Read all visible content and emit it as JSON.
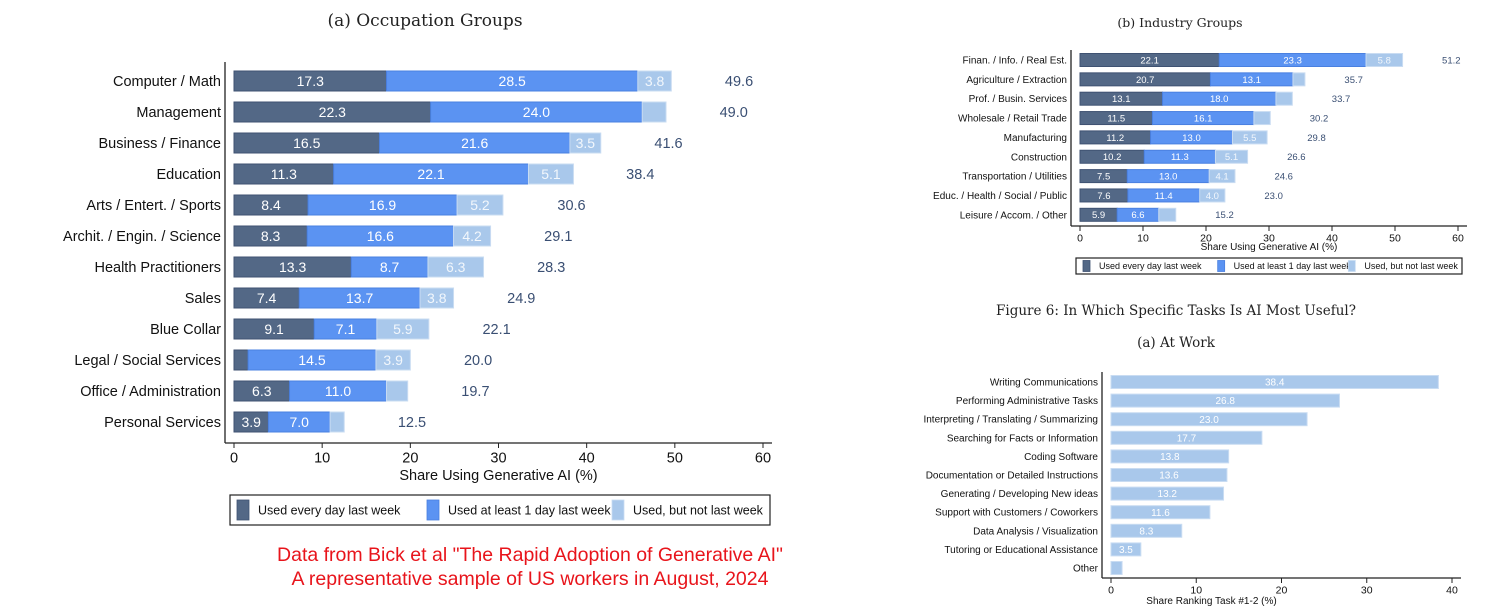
{
  "colors": {
    "daily": "#536886",
    "weekly": "#5b93f2",
    "notlast": "#a9c8eb",
    "total_label": "#3a4f73",
    "note": "#e8141b"
  },
  "chart_data": [
    {
      "id": "occupation",
      "type": "bar",
      "orientation": "horizontal",
      "stacked": true,
      "title": "(a) Occupation Groups",
      "xlabel": "Share Using Generative AI (%)",
      "xlim": [
        0,
        60
      ],
      "xticks": [
        0,
        10,
        20,
        30,
        40,
        50,
        60
      ],
      "legend": {
        "position": "bottom",
        "entries": [
          "Used every day last week",
          "Used at least 1 day last week",
          "Used, but not last week"
        ]
      },
      "categories": [
        "Computer / Math",
        "Management",
        "Business / Finance",
        "Education",
        "Arts / Entert. / Sports",
        "Archit. / Engin. / Science",
        "Health Practitioners",
        "Sales",
        "Blue Collar",
        "Legal / Social Services",
        "Office / Administration",
        "Personal Services"
      ],
      "series": [
        {
          "name": "Used every day last week",
          "values": [
            17.3,
            22.3,
            16.5,
            11.3,
            8.4,
            8.3,
            13.3,
            7.4,
            9.1,
            1.6,
            6.3,
            3.9
          ],
          "labels": [
            "17.3",
            "22.3",
            "16.5",
            "11.3",
            "8.4",
            "8.3",
            "13.3",
            "7.4",
            "9.1",
            "",
            "6.3",
            "3.9"
          ]
        },
        {
          "name": "Used at least 1 day last week",
          "values": [
            28.5,
            24.0,
            21.6,
            22.1,
            16.9,
            16.6,
            8.7,
            13.7,
            7.1,
            14.5,
            11.0,
            7.0
          ],
          "labels": [
            "28.5",
            "24.0",
            "21.6",
            "22.1",
            "16.9",
            "16.6",
            "8.7",
            "13.7",
            "7.1",
            "14.5",
            "11.0",
            "7.0"
          ]
        },
        {
          "name": "Used, but not last week",
          "values": [
            3.8,
            2.7,
            3.5,
            5.1,
            5.2,
            4.2,
            6.3,
            3.8,
            5.9,
            3.9,
            2.4,
            1.6
          ],
          "labels": [
            "3.8",
            "",
            "3.5",
            "5.1",
            "5.2",
            "4.2",
            "6.3",
            "3.8",
            "5.9",
            "3.9",
            "",
            ""
          ]
        }
      ],
      "totals": [
        "49.6",
        "49.0",
        "41.6",
        "38.4",
        "30.6",
        "29.1",
        "28.3",
        "24.9",
        "22.1",
        "20.0",
        "19.7",
        "12.5"
      ],
      "grid": false
    },
    {
      "id": "industry",
      "type": "bar",
      "orientation": "horizontal",
      "stacked": true,
      "title": "(b) Industry Groups",
      "xlabel": "Share Using Generative AI (%)",
      "xlim": [
        0,
        60
      ],
      "xticks": [
        0,
        10,
        20,
        30,
        40,
        50,
        60
      ],
      "legend": {
        "position": "bottom",
        "entries": [
          "Used every day last week",
          "Used at least 1 day last week",
          "Used, but not last week"
        ]
      },
      "categories": [
        "Finan. / Info. / Real Est.",
        "Agriculture / Extraction",
        "Prof. / Busin. Services",
        "Wholesale / Retail Trade",
        "Manufacturing",
        "Construction",
        "Transportation / Utilities",
        "Educ. / Health / Social / Public",
        "Leisure / Accom. / Other"
      ],
      "series": [
        {
          "name": "Used every day last week",
          "values": [
            22.1,
            20.7,
            13.1,
            11.5,
            11.2,
            10.2,
            7.5,
            7.6,
            5.9
          ],
          "labels": [
            "22.1",
            "20.7",
            "13.1",
            "11.5",
            "11.2",
            "10.2",
            "7.5",
            "7.6",
            "5.9"
          ]
        },
        {
          "name": "Used at least 1 day last week",
          "values": [
            23.3,
            13.1,
            18.0,
            16.1,
            13.0,
            11.3,
            13.0,
            11.4,
            6.6
          ],
          "labels": [
            "23.3",
            "13.1",
            "18.0",
            "16.1",
            "13.0",
            "11.3",
            "13.0",
            "11.4",
            "6.6"
          ]
        },
        {
          "name": "Used, but not last week",
          "values": [
            5.8,
            1.9,
            2.6,
            2.6,
            5.5,
            5.1,
            4.1,
            4.0,
            2.7
          ],
          "labels": [
            "5.8",
            "",
            "",
            "",
            "5.5",
            "5.1",
            "4.1",
            "4.0",
            ""
          ]
        }
      ],
      "totals": [
        "51.2",
        "35.7",
        "33.7",
        "30.2",
        "29.8",
        "26.6",
        "24.6",
        "23.0",
        "15.2"
      ],
      "grid": false
    },
    {
      "id": "tasks",
      "type": "bar",
      "orientation": "horizontal",
      "figure_title": "Figure 6: In Which Specific Tasks Is AI Most Useful?",
      "title": "(a) At Work",
      "xlabel": "Share Ranking Task #1-2 (%)",
      "xlim": [
        0,
        40
      ],
      "xticks": [
        0,
        10,
        20,
        30,
        40
      ],
      "categories": [
        "Writing Communications",
        "Performing Administrative Tasks",
        "Interpreting / Translating / Summarizing",
        "Searching for Facts or Information",
        "Coding Software",
        "Documentation or Detailed Instructions",
        "Generating / Developing New ideas",
        "Support with Customers / Coworkers",
        "Data Analysis / Visualization",
        "Tutoring or Educational Assistance",
        "Other"
      ],
      "values": [
        38.4,
        26.8,
        23.0,
        17.7,
        13.8,
        13.6,
        13.2,
        11.6,
        8.3,
        3.5,
        1.3
      ],
      "labels": [
        "38.4",
        "26.8",
        "23.0",
        "17.7",
        "13.8",
        "13.6",
        "13.2",
        "11.6",
        "8.3",
        "3.5",
        ""
      ],
      "grid": false
    }
  ],
  "note": {
    "line1": "Data from Bick et al \"The Rapid Adoption of Generative AI\"",
    "line2": "A representative sample of US workers in August, 2024"
  }
}
